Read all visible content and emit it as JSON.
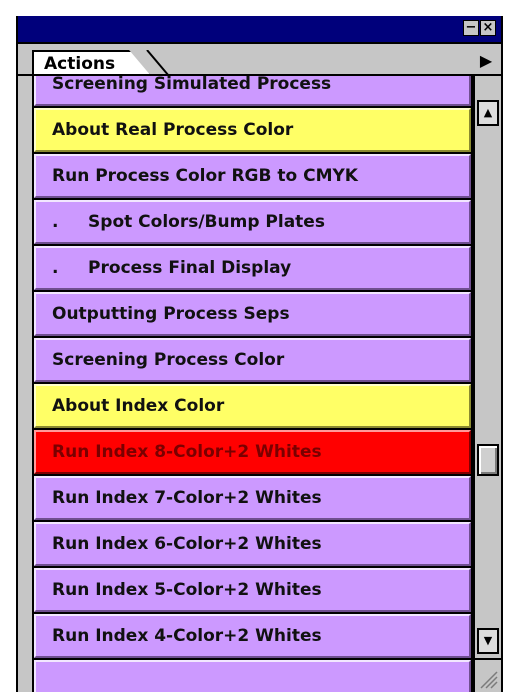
{
  "window": {
    "minimize_glyph": "−",
    "close_glyph": "×"
  },
  "panel": {
    "tab_label": "Actions",
    "menu_glyph": "▶"
  },
  "colors": {
    "title_bar": "#00007b",
    "row_purple": "#cc99ff",
    "row_yellow": "#ffff66",
    "row_red": "#ff0000"
  },
  "actions": [
    {
      "label": "Screening Simulated Process",
      "style": "purple"
    },
    {
      "label": "About Real Process Color",
      "style": "yellow"
    },
    {
      "label": "Run Process Color RGB to CMYK",
      "style": "purple"
    },
    {
      "label": ".     Spot Colors/Bump Plates",
      "style": "purple"
    },
    {
      "label": ".     Process Final Display",
      "style": "purple"
    },
    {
      "label": "Outputting Process Seps",
      "style": "purple"
    },
    {
      "label": "Screening Process Color",
      "style": "purple"
    },
    {
      "label": "About Index Color",
      "style": "yellow"
    },
    {
      "label": "Run Index 8-Color+2 Whites",
      "style": "red"
    },
    {
      "label": "Run Index 7-Color+2 Whites",
      "style": "purple"
    },
    {
      "label": "Run Index 6-Color+2 Whites",
      "style": "purple"
    },
    {
      "label": "Run Index 5-Color+2 Whites",
      "style": "purple"
    },
    {
      "label": "Run Index 4-Color+2 Whites",
      "style": "purple"
    },
    {
      "label": "",
      "style": "purple"
    }
  ],
  "scrollbar": {
    "up_glyph": "▲",
    "down_glyph": "▼"
  }
}
